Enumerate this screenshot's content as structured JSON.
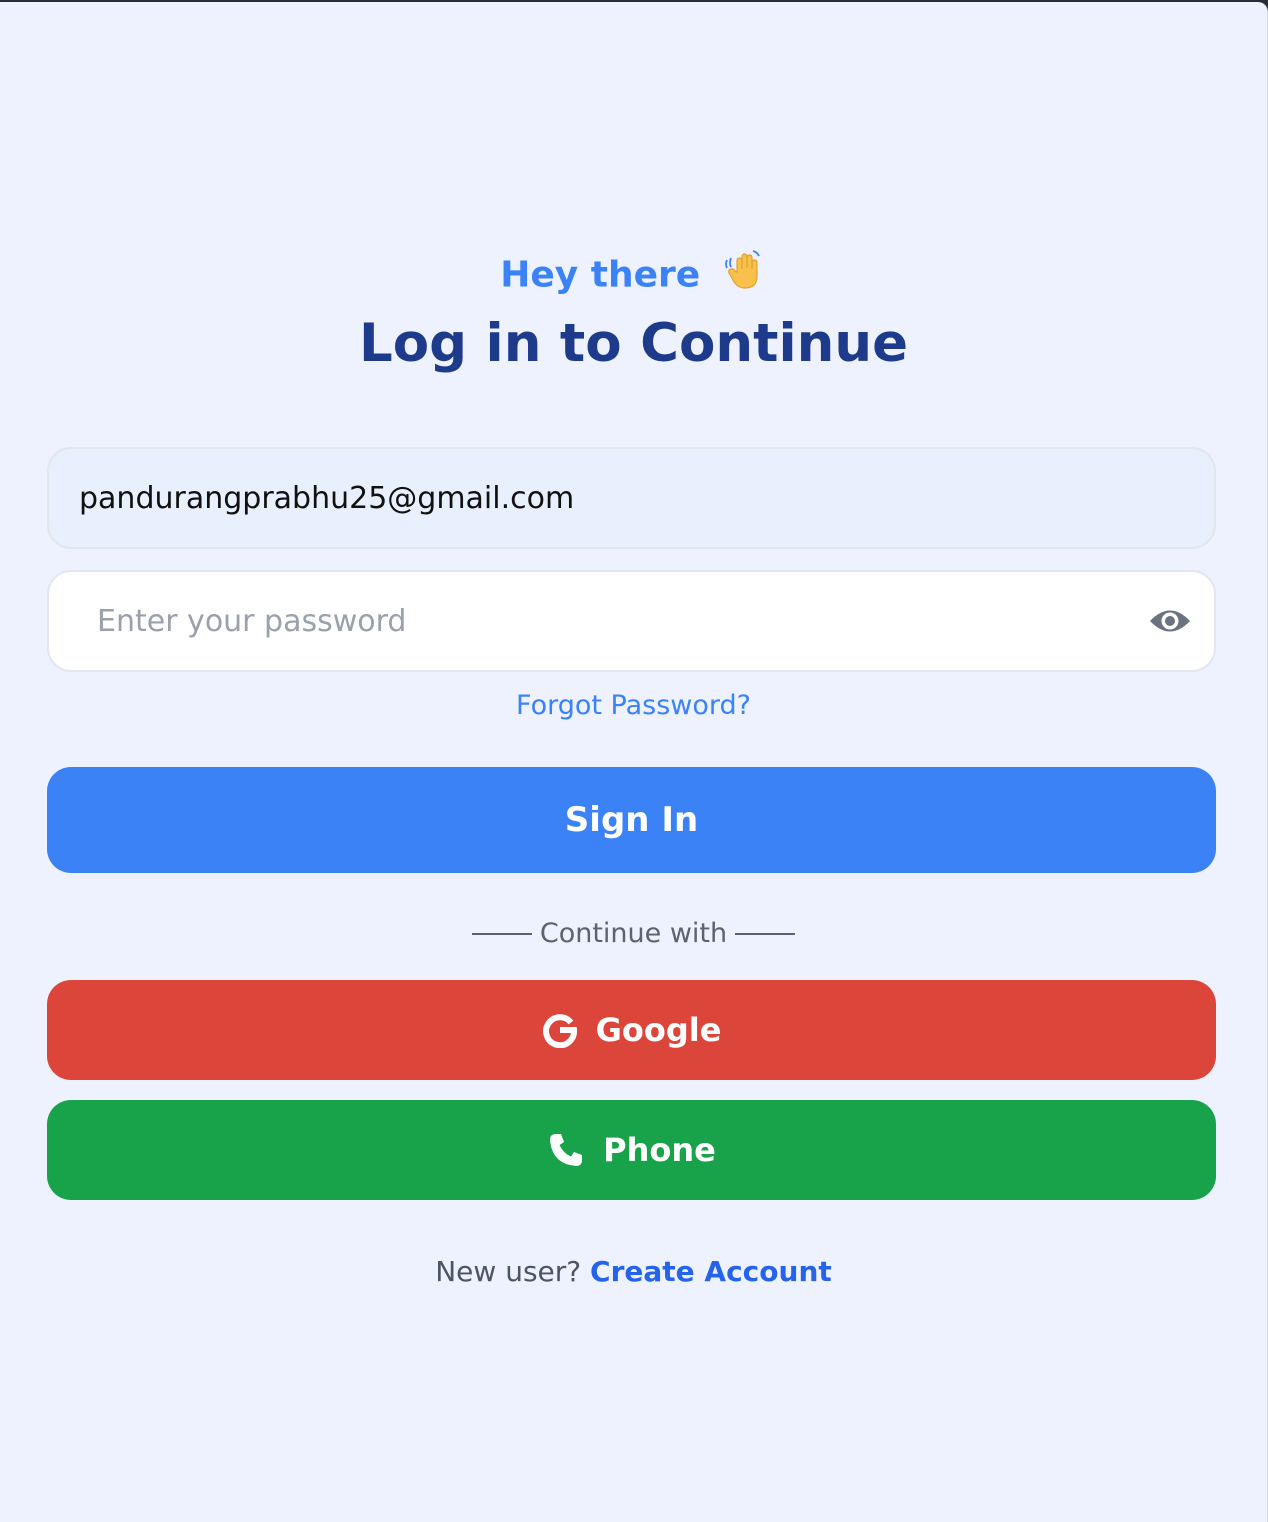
{
  "header": {
    "greeting": "Hey there",
    "greeting_icon": "waving-hand-icon",
    "title": "Log in to Continue"
  },
  "form": {
    "email_value": "pandurangprabhu25@gmail.com",
    "password_value": "",
    "password_placeholder": "Enter your password",
    "password_toggle_icon": "eye-icon",
    "forgot_password_label": "Forgot Password?",
    "sign_in_label": "Sign In"
  },
  "social": {
    "divider_label": "Continue with",
    "google_label": "Google",
    "google_icon": "google-icon",
    "phone_label": "Phone",
    "phone_icon": "phone-icon"
  },
  "footer": {
    "prompt": "New user?",
    "create_account_label": "Create Account"
  },
  "colors": {
    "background": "#eef2fe",
    "primary": "#3b82f6",
    "title": "#1e3a8a",
    "google": "#dc4539",
    "phone": "#18a34a",
    "link_strong": "#2563eb"
  }
}
